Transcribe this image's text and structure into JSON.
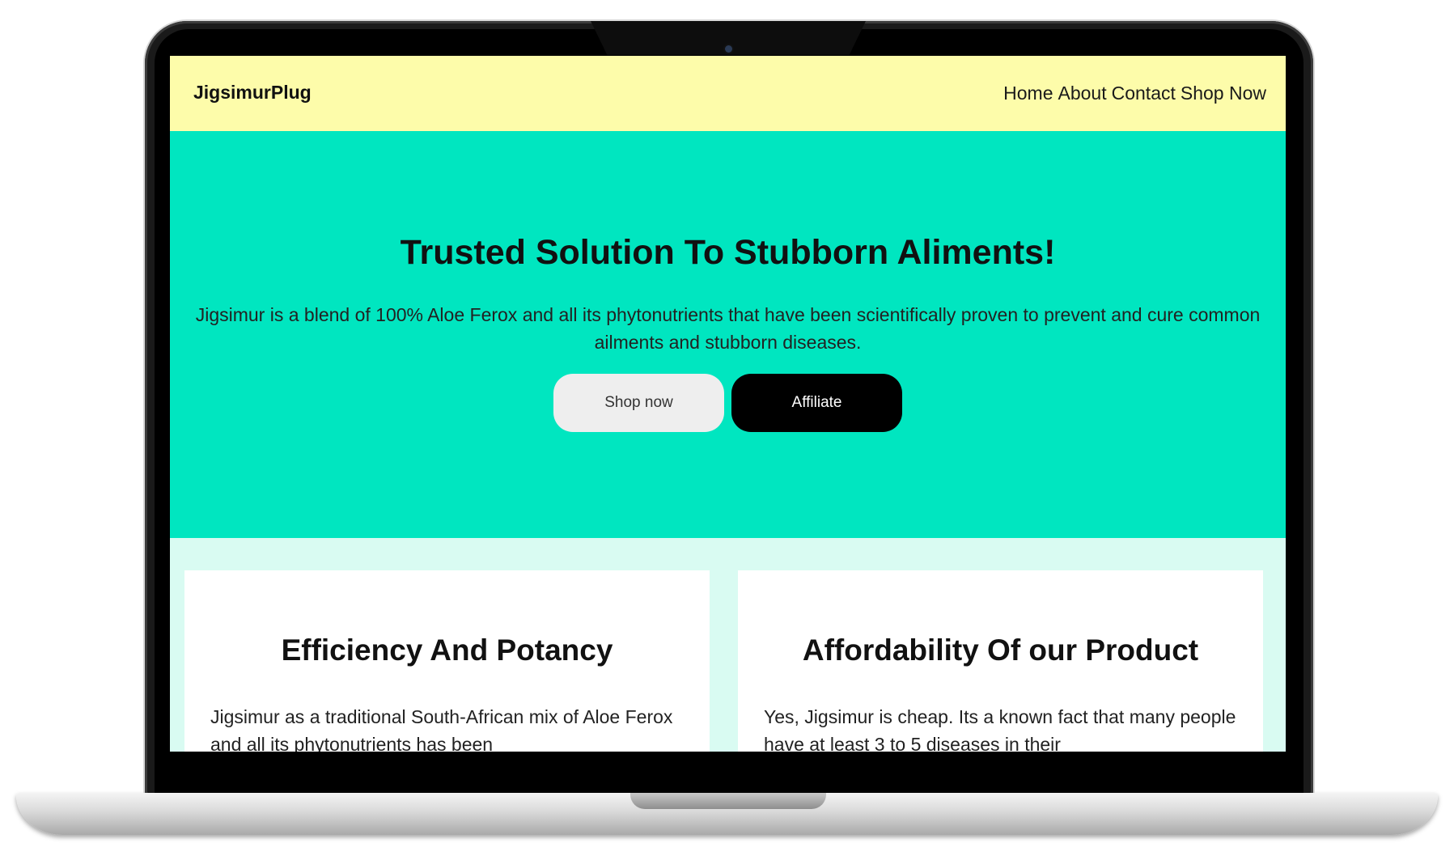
{
  "navbar": {
    "brand": "JigsimurPlug",
    "links": [
      "Home",
      "About",
      "Contact",
      "Shop Now"
    ]
  },
  "hero": {
    "title": "Trusted Solution To Stubborn Aliments!",
    "description": "Jigsimur is a blend of 100% Aloe Ferox and all its phytonutrients that have been scientifically proven to prevent and cure common ailments and stubborn diseases.",
    "buttons": {
      "shop": "Shop now",
      "affiliate": "Affiliate"
    }
  },
  "features": [
    {
      "title": "Efficiency And Potancy",
      "text": "Jigsimur as a traditional South-African mix of Aloe Ferox and all its phytonutrients has been"
    },
    {
      "title": "Affordability Of our Product",
      "text": "Yes, Jigsimur is cheap. Its a known fact that many people have at least 3 to 5 diseases in their"
    }
  ],
  "colors": {
    "navbar_bg": "#fdfcaa",
    "hero_bg": "#00e6c0",
    "section_bg": "#d9fbf2",
    "affiliate_button_bg": "#000000",
    "shop_button_bg": "#eeeeee"
  }
}
